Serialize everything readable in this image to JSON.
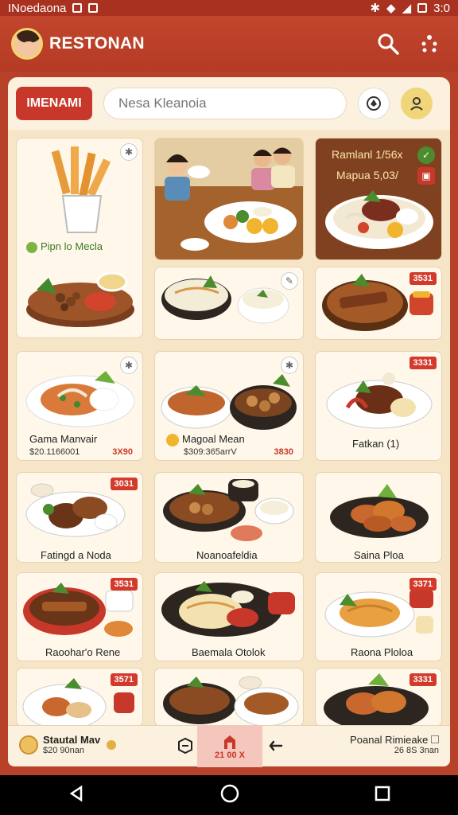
{
  "status": {
    "carrier": "INoedaona",
    "time": "3:0"
  },
  "header": {
    "brand": "RESTONAN"
  },
  "toolbar": {
    "menu_label": "IMENAMI",
    "search_placeholder": "Nesa Kleanoia"
  },
  "cards": {
    "c1": {
      "label": "Pipn lo Mecla"
    },
    "c3": {
      "line1": "Ramlanl 1/56x",
      "line2": "Mapua 5,03/"
    },
    "c5": {
      "tag": "3531"
    },
    "c7": {
      "title": "Gama Manvair",
      "sub": "$20.1166001",
      "price": "3X90"
    },
    "c8": {
      "title": "Magoal Mean",
      "sub": "$309:365arrV",
      "price": "3830"
    },
    "c9": {
      "title": "Fatkan (1)",
      "tag": "3331"
    },
    "c10": {
      "title": "Fatingd a Noda",
      "tag": "3031"
    },
    "c11": {
      "title": "Noanoafeldia"
    },
    "c12": {
      "title": "Saina Ploa"
    },
    "c13": {
      "title": "Raoohar'o Rene",
      "tag": "3531"
    },
    "c14": {
      "title": "Baemala Otolok"
    },
    "c15": {
      "title": "Raona Ploloa",
      "tag": "3371"
    },
    "c16": {
      "tag": "3571"
    },
    "c18": {
      "tag": "3331"
    }
  },
  "bottom": {
    "left_title": "Stautal Mav",
    "left_sub": "$20 90nan",
    "mid_label": "21 00 X",
    "right_title": "Poanal Rimieake",
    "right_sub": "26 8S 3nan"
  },
  "colors": {
    "brand_red": "#b8412a",
    "accent_red": "#c8382a",
    "panel_cream": "#fbf1de"
  }
}
